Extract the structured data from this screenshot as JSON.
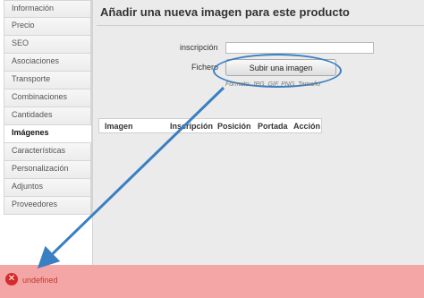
{
  "sidebar": {
    "items": [
      {
        "label": "Información"
      },
      {
        "label": "Precio"
      },
      {
        "label": "SEO"
      },
      {
        "label": "Asociaciones"
      },
      {
        "label": "Transporte"
      },
      {
        "label": "Combinaciones"
      },
      {
        "label": "Cantidades"
      },
      {
        "label": "Imágenes"
      },
      {
        "label": "Características"
      },
      {
        "label": "Personalización"
      },
      {
        "label": "Adjuntos"
      },
      {
        "label": "Proveedores"
      }
    ],
    "active_index": 7
  },
  "main": {
    "title": "Añadir una nueva imagen para este producto",
    "inscription_label": "inscripción",
    "inscription_value": "",
    "file_label": "Fichero",
    "upload_button": "Subir una imagen",
    "format_hint": "Formato: JPG, GIF, PNG. Tamaño",
    "table_headers": [
      "Imagen",
      "Inscripción",
      "Posición",
      "Portada",
      "Acción"
    ]
  },
  "error": {
    "icon": "error-x-icon",
    "message": "undefined"
  },
  "colors": {
    "annotation_blue": "#3a7fc2",
    "error_background": "#f4a6a6",
    "error_icon": "#d42b2b"
  }
}
